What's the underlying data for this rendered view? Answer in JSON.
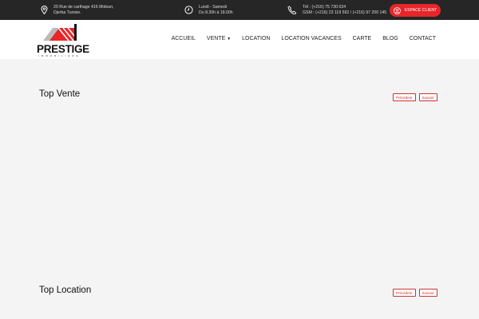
{
  "topbar": {
    "address": [
      "20 Rue de carthage 416 Midoun,",
      "Djerba Tunisie."
    ],
    "hours": [
      "Lundi - Samedi",
      "Du 8.30h à 18.00h"
    ],
    "phone": [
      "Tél : (+216) 75 730 034",
      "GSM : (+216) 23 119 592 / (+216) 97 200 145"
    ],
    "client_button": "ESPACE CLIENT"
  },
  "logo": {
    "name": "PRESTIGE",
    "sub": "IMMOBILIÈRE"
  },
  "nav": [
    "ACCUEIL",
    "VENTE",
    "LOCATION",
    "LOCATION VACANCES",
    "CARTE",
    "BLOG",
    "CONTACT"
  ],
  "sections": [
    {
      "title": "Top Vente",
      "prev": "Précédent",
      "next": "Suivant"
    },
    {
      "title": "Top Location",
      "prev": "Précédent",
      "next": "Suivant"
    }
  ],
  "colors": {
    "accent": "#e8262a",
    "topbar": "#262626"
  }
}
